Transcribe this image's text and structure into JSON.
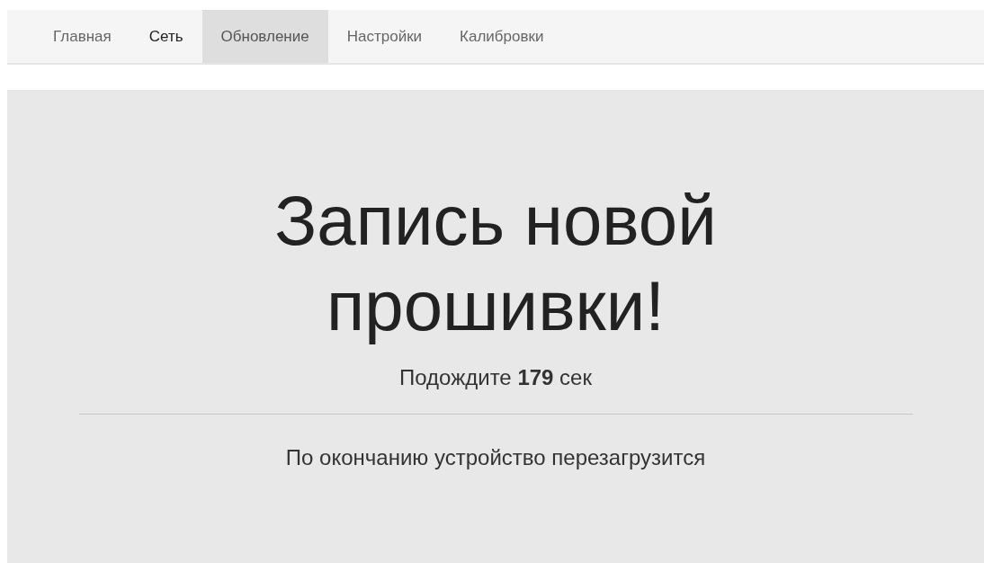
{
  "nav": {
    "items": [
      {
        "label": "Главная",
        "selected": false,
        "hovered": false
      },
      {
        "label": "Сеть",
        "selected": false,
        "hovered": true
      },
      {
        "label": "Обновление",
        "selected": true,
        "hovered": false
      },
      {
        "label": "Настройки",
        "selected": false,
        "hovered": false
      },
      {
        "label": "Калибровки",
        "selected": false,
        "hovered": false
      }
    ]
  },
  "panel": {
    "title": "Запись новой прошивки!",
    "wait": "Подождите **179** сек",
    "note": "По окончанию устройство перезагрузится"
  }
}
